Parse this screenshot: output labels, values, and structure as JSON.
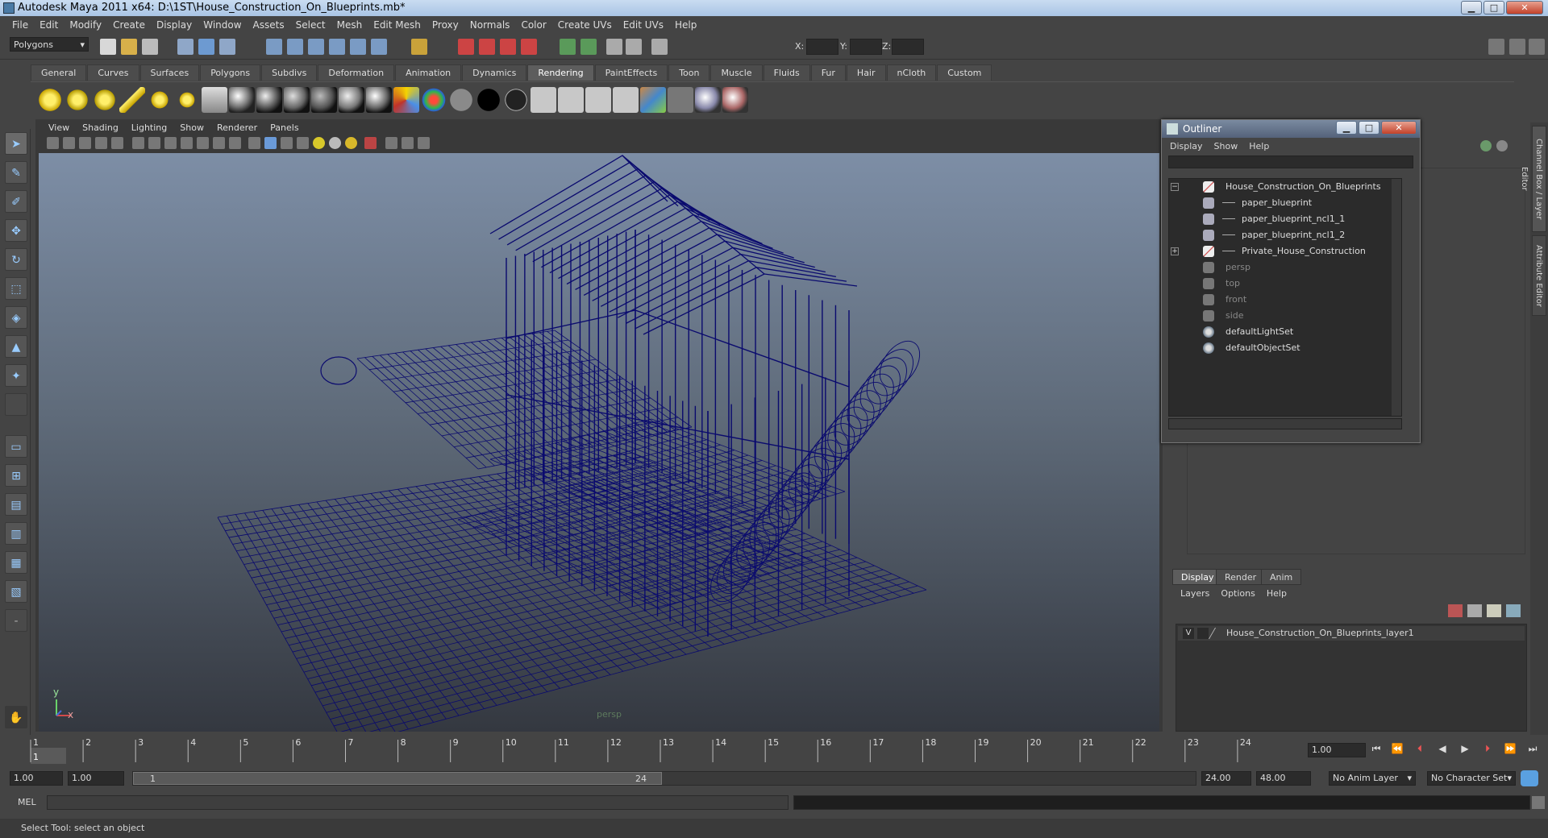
{
  "window": {
    "title": "Autodesk Maya 2011 x64: D:\\1ST\\House_Construction_On_Blueprints.mb*"
  },
  "menubar": [
    "File",
    "Edit",
    "Modify",
    "Create",
    "Display",
    "Window",
    "Assets",
    "Select",
    "Mesh",
    "Edit Mesh",
    "Proxy",
    "Normals",
    "Color",
    "Create UVs",
    "Edit UVs",
    "Help"
  ],
  "statusline": {
    "mode": "Polygons",
    "x_label": "X:",
    "y_label": "Y:",
    "z_label": "Z:"
  },
  "shelf_tabs": [
    "General",
    "Curves",
    "Surfaces",
    "Polygons",
    "Subdivs",
    "Deformation",
    "Animation",
    "Dynamics",
    "Rendering",
    "PaintEffects",
    "Toon",
    "Muscle",
    "Fluids",
    "Fur",
    "Hair",
    "nCloth",
    "Custom"
  ],
  "active_shelf_tab": "Rendering",
  "viewport": {
    "menu": [
      "View",
      "Shading",
      "Lighting",
      "Show",
      "Renderer",
      "Panels"
    ],
    "camera_label": "persp",
    "axis_y": "y",
    "axis_x": "x",
    "wire_color": "#0a0a6e"
  },
  "outliner": {
    "title": "Outliner",
    "menu": [
      "Display",
      "Show",
      "Help"
    ],
    "items": [
      {
        "label": "House_Construction_On_Blueprints",
        "expander": "−"
      },
      {
        "label": "paper_blueprint"
      },
      {
        "label": "paper_blueprint_ncl1_1"
      },
      {
        "label": "paper_blueprint_ncl1_2"
      },
      {
        "label": "Private_House_Construction",
        "expander": "+"
      },
      {
        "label": "persp"
      },
      {
        "label": "top"
      },
      {
        "label": "front"
      },
      {
        "label": "side"
      },
      {
        "label": "defaultLightSet"
      },
      {
        "label": "defaultObjectSet"
      }
    ]
  },
  "layer_editor": {
    "tabs": [
      "Display",
      "Render",
      "Anim"
    ],
    "menu": [
      "Layers",
      "Options",
      "Help"
    ],
    "layer": {
      "visible": "V",
      "name": "House_Construction_On_Blueprints_layer1"
    }
  },
  "side_tabs": [
    "Channel Box / Layer Editor",
    "Attribute Editor"
  ],
  "timeline": {
    "ticks": [
      "1",
      "2",
      "3",
      "4",
      "5",
      "6",
      "7",
      "8",
      "9",
      "10",
      "11",
      "12",
      "13",
      "14",
      "15",
      "16",
      "17",
      "18",
      "19",
      "20",
      "21",
      "22",
      "23",
      "24"
    ],
    "current_frame": "1",
    "current_time_field": "1.00"
  },
  "range": {
    "start_field": "1.00",
    "playback_start": "1.00",
    "range_start_label": "1",
    "range_end_label": "24",
    "playback_end": "24.00",
    "end_field": "48.00",
    "anim_layer": "No Anim Layer",
    "character_set": "No Character Set"
  },
  "cmdline": {
    "label": "MEL"
  },
  "helpline": {
    "text": "Select Tool: select an object"
  }
}
